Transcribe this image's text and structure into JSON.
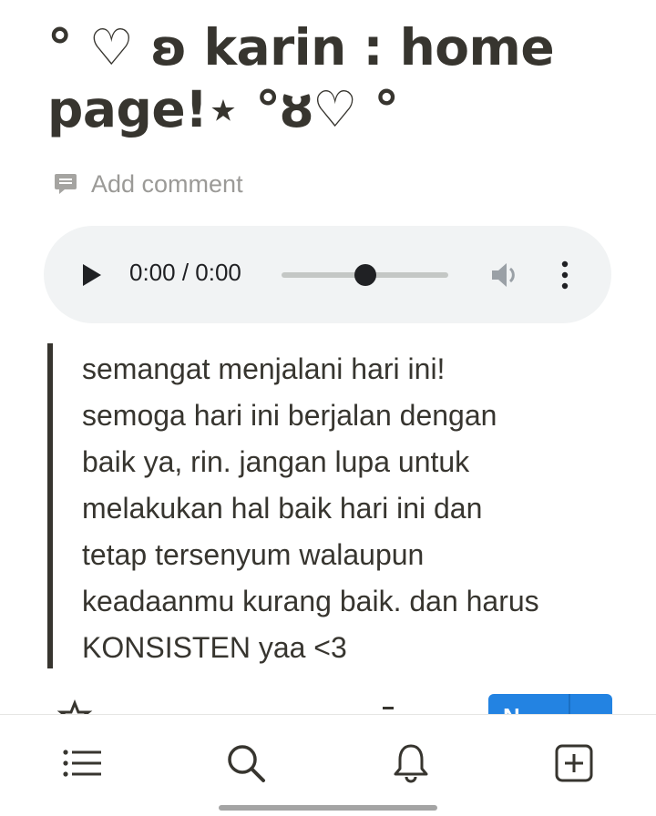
{
  "page": {
    "title_line1": "° ♡ ʚ karin : home",
    "title_line2": "page!⋆  °ȣ♡ °"
  },
  "comment": {
    "label": "Add comment",
    "icon": "comment-icon"
  },
  "audio_player": {
    "time_display": "0:00 / 0:00",
    "progress": 0.5,
    "icons": [
      "play-icon",
      "volume-icon",
      "more-vertical-icon"
    ]
  },
  "quote": {
    "lines": [
      "semangat menjalani hari ini!",
      "semoga hari ini berjalan dengan",
      "baik ya, rin. jangan lupa untuk",
      "melakukan hal baik hari ini dan",
      "tetap tersenyum walaupun",
      "keadaanmu kurang baik. dan harus",
      "KONSISTEN yaa <3"
    ]
  },
  "peek_button": {
    "label": "N"
  },
  "bottom_nav": {
    "items": [
      {
        "name": "list-icon"
      },
      {
        "name": "search-icon"
      },
      {
        "name": "bell-icon"
      },
      {
        "name": "new-page-icon"
      }
    ]
  },
  "colors": {
    "text": "#37352f",
    "muted": "#9b9a97",
    "accent": "#2383e2",
    "player_bg": "#f1f3f4"
  }
}
